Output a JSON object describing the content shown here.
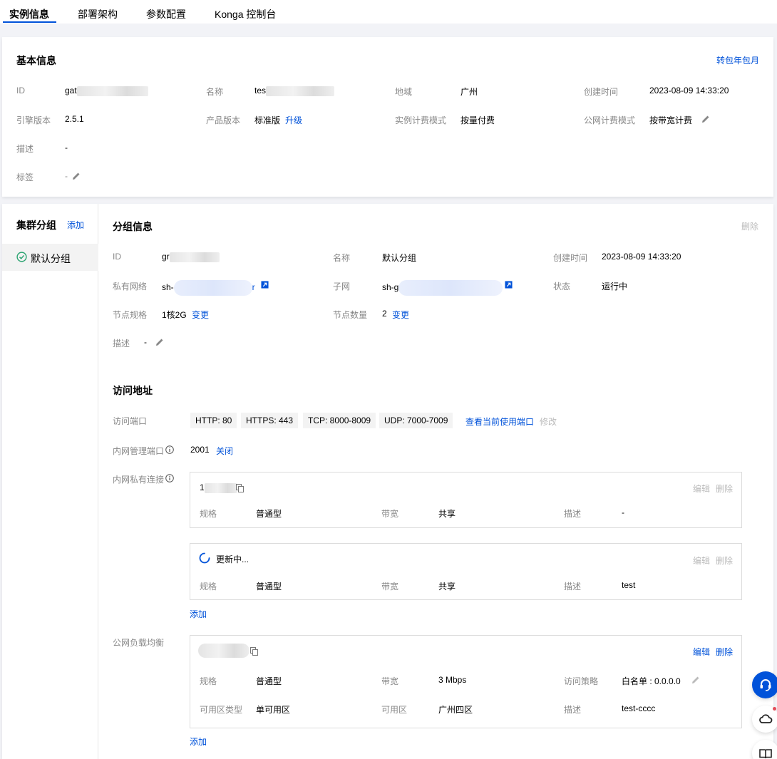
{
  "tabs": [
    "实例信息",
    "部署架构",
    "参数配置",
    "Konga 控制台"
  ],
  "basic": {
    "title": "基本信息",
    "action": "转包年包月",
    "fields": {
      "id_label": "ID",
      "id_value": "gat",
      "name_label": "名称",
      "name_value": "tes",
      "region_label": "地域",
      "region_value": "广州",
      "created_label": "创建时间",
      "created_value": "2023-08-09 14:33:20",
      "engine_label": "引擎版本",
      "engine_value": "2.5.1",
      "product_label": "产品版本",
      "product_value": "标准版",
      "product_link": "升级",
      "billing_label": "实例计费模式",
      "billing_value": "按量付费",
      "net_billing_label": "公网计费模式",
      "net_billing_value": "按带宽计费",
      "desc_label": "描述",
      "desc_value": "-",
      "tag_label": "标签",
      "tag_value": "-"
    }
  },
  "sidebar": {
    "title": "集群分组",
    "add": "添加",
    "items": [
      {
        "label": "默认分组",
        "status_color": "#2ba471"
      }
    ]
  },
  "group": {
    "title": "分组信息",
    "delete": "删除",
    "id_label": "ID",
    "id_value": "gr",
    "name_label": "名称",
    "name_value": "默认分组",
    "created_label": "创建时间",
    "created_value": "2023-08-09 14:33:20",
    "vpc_label": "私有网络",
    "vpc_value": "sh-",
    "vpc_tail": "r",
    "subnet_label": "子网",
    "subnet_value": "sh-g",
    "status_label": "状态",
    "status_value": "运行中",
    "spec_label": "节点规格",
    "spec_value": "1核2G",
    "spec_link": "变更",
    "count_label": "节点数量",
    "count_value": "2",
    "count_link": "变更",
    "desc_label": "描述",
    "desc_value": "-"
  },
  "access": {
    "title": "访问地址",
    "port_label": "访问端口",
    "ports": [
      "HTTP: 80",
      "HTTPS: 443",
      "TCP: 8000-8009",
      "UDP: 7000-7009"
    ],
    "port_link": "查看当前使用端口",
    "port_modify": "修改",
    "mgmt_label": "内网管理端口",
    "mgmt_value": "2001",
    "mgmt_link": "关闭",
    "private_label": "内网私有连接",
    "private_items": [
      {
        "header": "1",
        "edit": "编辑",
        "delete": "删除",
        "spec_label": "规格",
        "spec_value": "普通型",
        "bw_label": "带宽",
        "bw_value": "共享",
        "desc_label": "描述",
        "desc_value": "-"
      },
      {
        "header": "更新中...",
        "edit": "编辑",
        "delete": "删除",
        "spec_label": "规格",
        "spec_value": "普通型",
        "bw_label": "带宽",
        "bw_value": "共享",
        "desc_label": "描述",
        "desc_value": "test"
      }
    ],
    "private_add": "添加",
    "public_label": "公网负载均衡",
    "public_item": {
      "edit": "编辑",
      "delete": "删除",
      "spec_label": "规格",
      "spec_value": "普通型",
      "bw_label": "带宽",
      "bw_value": "3 Mbps",
      "policy_label": "访问策略",
      "policy_value": "白名单 : 0.0.0.0",
      "zone_type_label": "可用区类型",
      "zone_type_value": "单可用区",
      "zone_label": "可用区",
      "zone_value": "广州四区",
      "desc_label": "描述",
      "desc_value": "test-cccc"
    },
    "public_add": "添加"
  },
  "colors": {
    "accent": "#0052d9",
    "muted": "#888888",
    "success": "#2ba471"
  },
  "floating": [
    "headset-icon",
    "cloud-icon",
    "book-icon"
  ]
}
